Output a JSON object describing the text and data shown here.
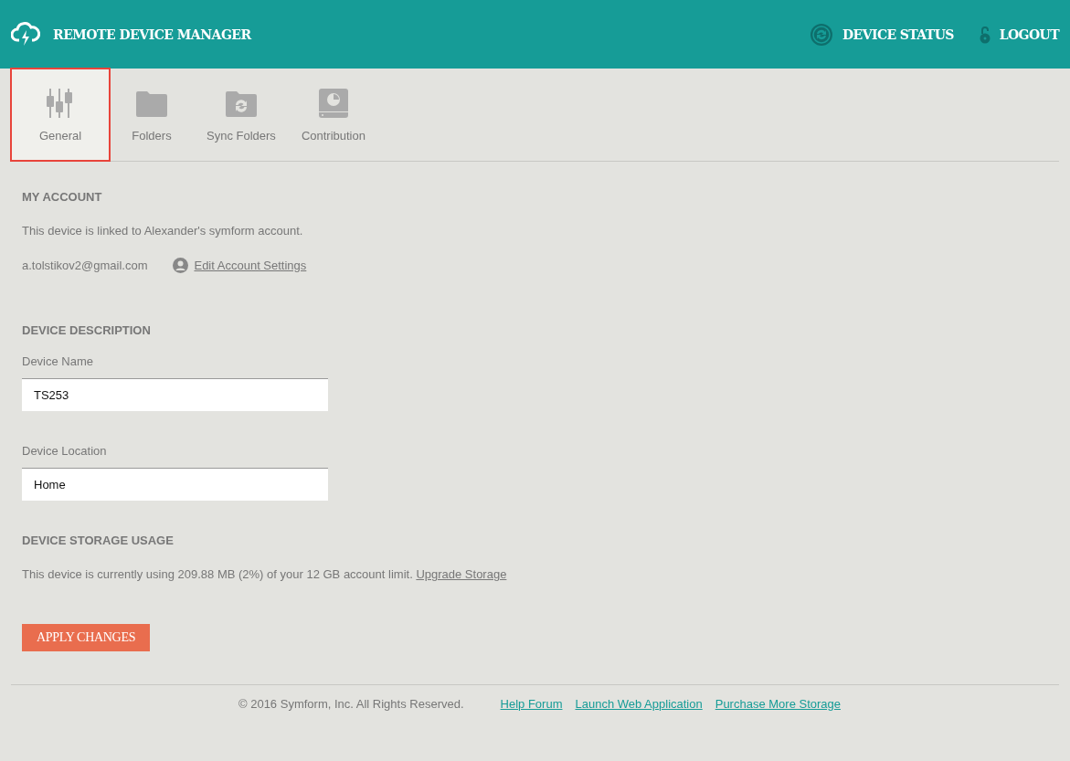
{
  "header": {
    "title": "REMOTE DEVICE MANAGER",
    "actions": [
      {
        "label": "DEVICE STATUS",
        "kind": "status"
      },
      {
        "label": "LOGOUT",
        "kind": "lock"
      }
    ]
  },
  "tabs": [
    {
      "label": "General",
      "kind": "sliders",
      "selected": true
    },
    {
      "label": "Folders",
      "kind": "folder",
      "selected": false
    },
    {
      "label": "Sync Folders",
      "kind": "sync-folder",
      "selected": false
    },
    {
      "label": "Contribution",
      "kind": "disk",
      "selected": false
    }
  ],
  "account": {
    "heading": "MY ACCOUNT",
    "linked_text": "This device is linked to Alexander's symform account.",
    "email": "a.tolstikov2@gmail.com",
    "edit_link": "Edit Account Settings"
  },
  "description": {
    "heading": "DEVICE DESCRIPTION",
    "fields": [
      {
        "label": "Device Name",
        "value": "TS253"
      },
      {
        "label": "Device Location",
        "value": "Home"
      }
    ]
  },
  "storage": {
    "heading": "DEVICE STORAGE USAGE",
    "text": "This device is currently using 209.88 MB (2%) of your 12 GB account limit.",
    "link": "Upgrade Storage"
  },
  "apply_button": "APPLY CHANGES",
  "footer": {
    "copyright": "© 2016 Symform, Inc. All Rights Reserved.",
    "links": [
      "Help Forum",
      "Launch Web Application",
      "Purchase More Storage"
    ]
  }
}
